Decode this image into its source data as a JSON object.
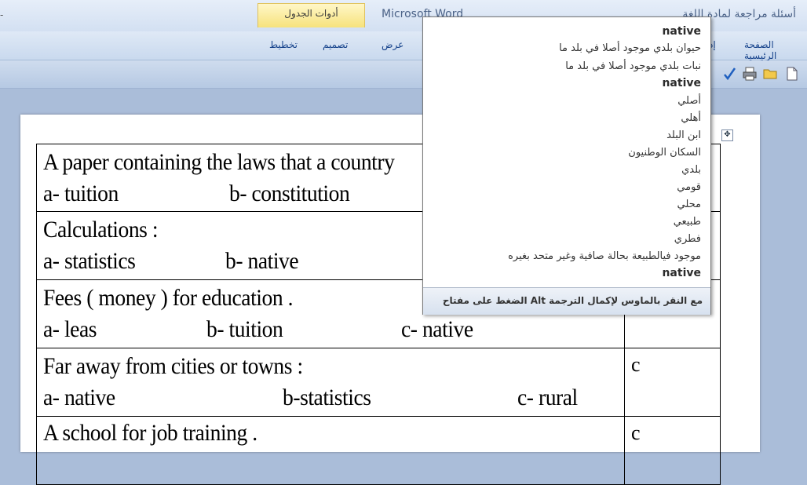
{
  "titlebar": {
    "left_mark": "-",
    "table_tools": "أدوات الجدول",
    "app_title": "Microsoft Word",
    "doc_title": "أسئلة مراجعة لمادة اللغة"
  },
  "ribbon": {
    "tabs": [
      "تخطيط",
      "تصميم",
      "عرض",
      "إد",
      "الصفحة الرئيسية"
    ]
  },
  "quick_access": {
    "icons": [
      "new-document-icon",
      "open-folder-icon",
      "print-icon",
      "spelling-check-icon"
    ]
  },
  "questions": [
    {
      "prompt": "A paper containing the laws that a country",
      "options": [
        "a- tuition",
        "b- constitution"
      ],
      "answer": ""
    },
    {
      "prompt": "Calculations :",
      "options": [
        "a- statistics",
        "b- native"
      ],
      "answer": ""
    },
    {
      "prompt": "Fees ( money ) for education .",
      "options": [
        "a- leas",
        "b- tuition",
        "c- native"
      ],
      "answer": ""
    },
    {
      "prompt": "Far away from cities or towns :",
      "options": [
        "a- native",
        "b-statistics",
        "c- rural"
      ],
      "answer": "c"
    },
    {
      "prompt": "A school for job training .",
      "options": [],
      "answer": "c"
    }
  ],
  "tooltip": {
    "lines": [
      {
        "text": "native",
        "head": true
      },
      {
        "text": "حيوان بلدي موجود أصلا في بلد ما",
        "head": false
      },
      {
        "text": "نبات بلدي موجود أصلا في بلد ما",
        "head": false
      },
      {
        "text": "native",
        "head": true
      },
      {
        "text": "أصلي",
        "head": false
      },
      {
        "text": "أهلي",
        "head": false
      },
      {
        "text": "ابن البلد",
        "head": false
      },
      {
        "text": "السكان الوطنيون",
        "head": false
      },
      {
        "text": "بلدي",
        "head": false
      },
      {
        "text": "قومي",
        "head": false
      },
      {
        "text": "محلي",
        "head": false
      },
      {
        "text": "طبيعي",
        "head": false
      },
      {
        "text": "فطري",
        "head": false
      },
      {
        "text": "موجود فيالطبيعة بحالة صافية وغير متحد بغيره",
        "head": false
      },
      {
        "text": "native",
        "head": true
      }
    ],
    "footer": "الضغط على مفتاح Alt مع النقر بالماوس لإكمال الترجمة"
  }
}
